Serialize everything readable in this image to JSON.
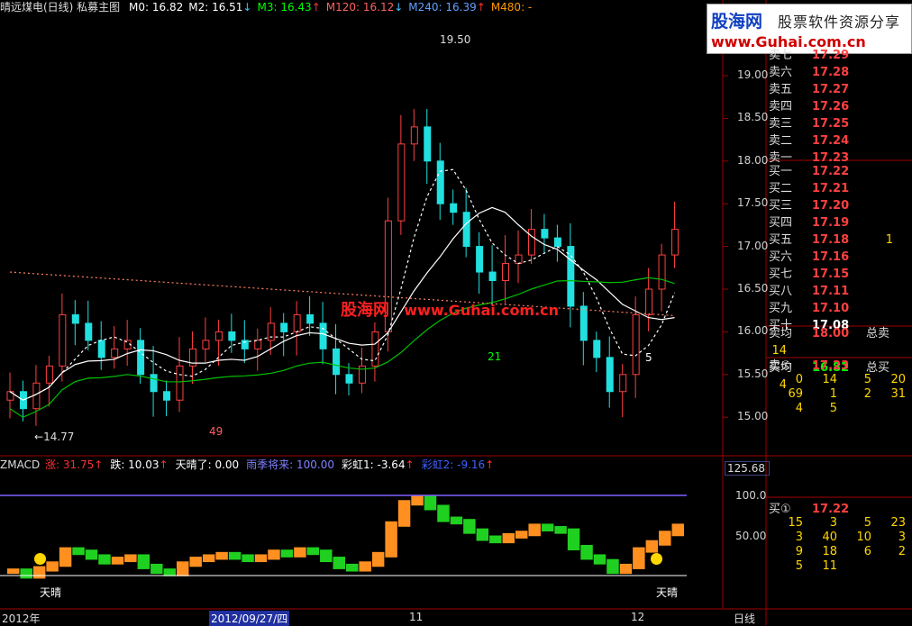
{
  "header": {
    "title": "晴远煤电(日线) 私募主图",
    "ma": [
      {
        "label": "M0: 16.82",
        "color": "#ffffff"
      },
      {
        "label": "M2: 16.51",
        "color": "#ffffff",
        "arrow": "↓"
      },
      {
        "label": "M3: 16.43",
        "color": "#00ff00",
        "arrow": "↑"
      },
      {
        "label": "M120: 16.12",
        "color": "#ff6060",
        "arrow": "↓"
      },
      {
        "label": "M240: 16.39",
        "color": "#60a0ff",
        "arrow": "↑"
      },
      {
        "label": "M480: -",
        "color": "#ff9900"
      }
    ]
  },
  "watermark": {
    "logo_cn": "股海网",
    "logo_tag": "股票软件资源分享",
    "logo_url": "www.Guhai.com.cn",
    "center_cn": "股海网",
    "center_url": "www.Guhai.com.cn"
  },
  "main_chart": {
    "price_scale": [
      "19.00",
      "18.50",
      "18.00",
      "17.50",
      "17.00",
      "16.50",
      "16.00",
      "15.50",
      "15.00"
    ],
    "high_label": "19.50",
    "low_label": "14.77",
    "annotations": [
      "49",
      "21",
      "5"
    ]
  },
  "sub_chart": {
    "indicator": "ZMACD",
    "values": [
      {
        "label": "涨: 31.75",
        "color": "#ff3030",
        "arrow": "↑"
      },
      {
        "label": "跌: 10.03",
        "color": "#ffffff",
        "arrow": "↑"
      },
      {
        "label": "天晴了: 0.00",
        "color": "#ffffff"
      },
      {
        "label": "雨季将来: 100.00",
        "color": "#8080ff"
      },
      {
        "label": "彩虹1: -3.64",
        "color": "#ffffff",
        "arrow": "↑"
      },
      {
        "label": "彩虹2: -9.16",
        "color": "#4060ff",
        "arrow": "↑"
      }
    ],
    "scale_top": "125.68",
    "scale": [
      "100.0",
      "50.00"
    ],
    "sun_label": "天晴",
    "sun_label_2": "天晴"
  },
  "time_axis": {
    "labels": [
      "2012年",
      "2012/09/27/四",
      "11",
      "12"
    ],
    "period": "日线"
  },
  "order_book": {
    "sells": [
      {
        "label": "卖七",
        "price": "17.29"
      },
      {
        "label": "卖六",
        "price": "17.28"
      },
      {
        "label": "卖五",
        "price": "17.27"
      },
      {
        "label": "卖四",
        "price": "17.26"
      },
      {
        "label": "卖三",
        "price": "17.25"
      },
      {
        "label": "卖二",
        "price": "17.24"
      },
      {
        "label": "卖一",
        "price": "17.23"
      }
    ],
    "buys": [
      {
        "label": "买一",
        "price": "17.22"
      },
      {
        "label": "买二",
        "price": "17.21"
      },
      {
        "label": "买三",
        "price": "17.20"
      },
      {
        "label": "买四",
        "price": "17.19"
      },
      {
        "label": "买五",
        "price": "17.18",
        "qty": "1"
      },
      {
        "label": "买六",
        "price": "17.16"
      },
      {
        "label": "买七",
        "price": "17.15"
      },
      {
        "label": "买八",
        "price": "17.11"
      },
      {
        "label": "买九",
        "price": "17.10"
      },
      {
        "label": "买十",
        "price": "17.08"
      }
    ],
    "avg_sell": {
      "label": "卖均",
      "price": "18.00",
      "total_label": "总卖",
      "total": "14"
    },
    "avg_buy": {
      "label": "买均",
      "price": "16.82",
      "total_label": "总买",
      "total": "4"
    },
    "sell1": {
      "label": "卖①",
      "price": "17.23"
    },
    "sell1_grid": [
      [
        "0",
        "14",
        "5",
        "20"
      ],
      [
        "69",
        "1",
        "2",
        "31"
      ],
      [
        "4",
        "5",
        "",
        ""
      ]
    ],
    "buy1": {
      "label": "买①",
      "price": "17.22"
    },
    "buy1_grid": [
      [
        "15",
        "3",
        "5",
        "23"
      ],
      [
        "3",
        "40",
        "10",
        "3"
      ],
      [
        "9",
        "18",
        "6",
        "2"
      ],
      [
        "5",
        "11",
        "",
        ""
      ]
    ]
  },
  "chart_data": {
    "type": "candlestick",
    "ylim": [
      14.6,
      19.9
    ],
    "high": 19.5,
    "low": 14.77,
    "last": 17.22
  }
}
